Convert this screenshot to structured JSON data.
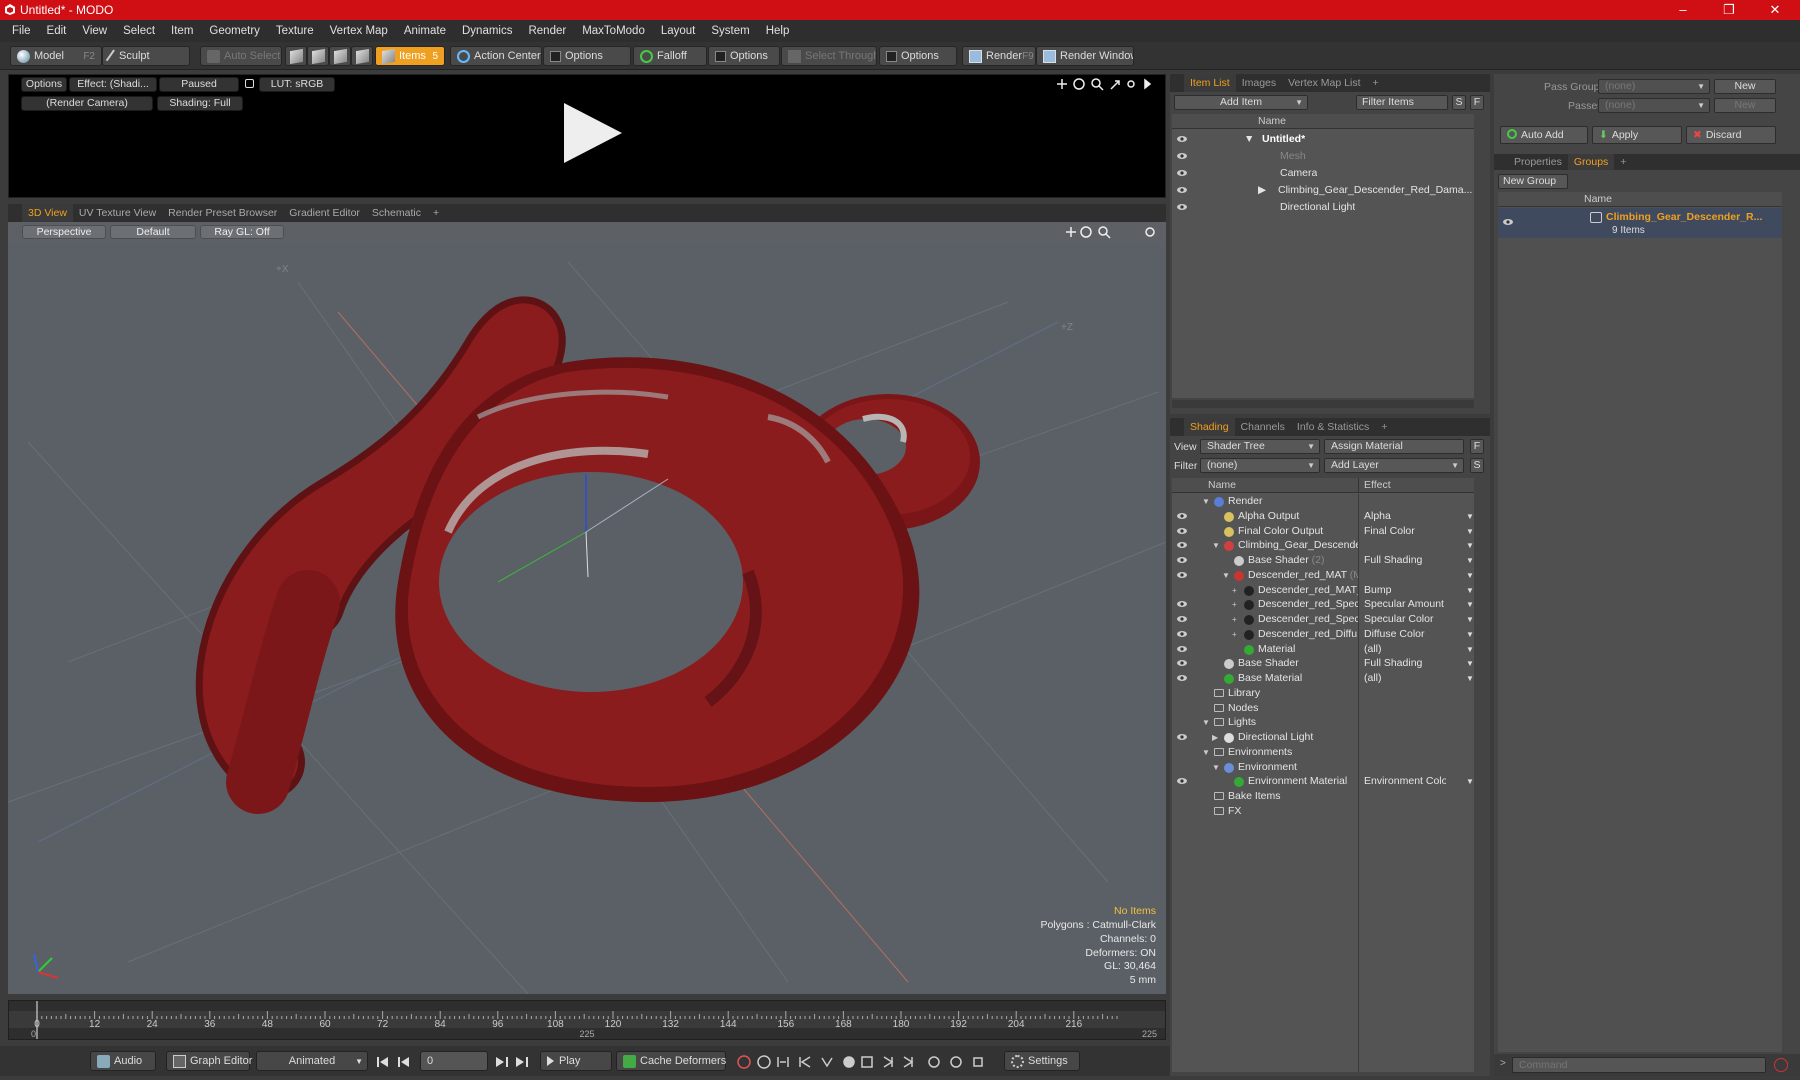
{
  "window": {
    "title": "Untitled* - MODO",
    "min": "–",
    "max": "❐",
    "close": "✕"
  },
  "menu": [
    "File",
    "Edit",
    "View",
    "Select",
    "Item",
    "Geometry",
    "Texture",
    "Vertex Map",
    "Animate",
    "Dynamics",
    "Render",
    "MaxToModo",
    "Layout",
    "System",
    "Help"
  ],
  "toolbar": {
    "model": "Model",
    "model_key": "F2",
    "sculpt": "Sculpt",
    "auto_select": "Auto Select",
    "items": "Items",
    "items_key": "5",
    "action_center": "Action Center",
    "options1": "Options",
    "falloff": "Falloff",
    "options2": "Options",
    "select_through": "Select Through",
    "options3": "Options",
    "render": "Render",
    "render_key": "F9",
    "render_window": "Render Window"
  },
  "preview": {
    "options": "Options",
    "effect": "Effect: (Shadi...",
    "paused": "Paused",
    "lut": "LUT: sRGB",
    "camera": "(Render Camera)",
    "shading": "Shading: Full"
  },
  "view_tabs": [
    "3D View",
    "UV Texture View",
    "Render Preset Browser",
    "Gradient Editor",
    "Schematic",
    "+"
  ],
  "viewport": {
    "perspective": "Perspective",
    "default": "Default",
    "raygl": "Ray GL: Off",
    "axis_x": "+X",
    "axis_z": "+Z",
    "info": {
      "no_items": "No Items",
      "polygons": "Polygons : Catmull-Clark",
      "channels": "Channels: 0",
      "deformers": "Deformers: ON",
      "gl": "GL: 30,464",
      "scale": "5 mm"
    }
  },
  "timeline": {
    "ticks": [
      "0",
      "12",
      "24",
      "36",
      "48",
      "60",
      "72",
      "84",
      "96",
      "108",
      "120",
      "132",
      "144",
      "156",
      "168",
      "180",
      "192",
      "204",
      "216"
    ],
    "start": "0",
    "mid": "225",
    "end": "225"
  },
  "bottom": {
    "audio": "Audio",
    "graph_editor": "Graph Editor",
    "animated": "Animated",
    "frame": "0",
    "play": "Play",
    "cache_deformers": "Cache Deformers",
    "settings": "Settings"
  },
  "item_list": {
    "tabs": [
      "Item List",
      "Images",
      "Vertex Map List",
      "+"
    ],
    "add_item": "Add Item",
    "filter_items": "Filter Items",
    "s": "S",
    "f": "F",
    "col_name": "Name",
    "items": [
      {
        "label": "Untitled*"
      },
      {
        "label": "Mesh"
      },
      {
        "label": "Camera"
      },
      {
        "label": "Climbing_Gear_Descender_Red_Dama..."
      },
      {
        "label": "Directional Light"
      }
    ]
  },
  "shading": {
    "tabs": [
      "Shading",
      "Channels",
      "Info & Statistics",
      "+"
    ],
    "view_label": "View",
    "view_value": "Shader Tree",
    "assign_material": "Assign Material",
    "filter_label": "Filter",
    "filter_value": "(none)",
    "add_layer": "Add Layer",
    "f": "F",
    "s": "S",
    "col_name": "Name",
    "col_effect": "Effect",
    "rows": [
      {
        "name": "Render",
        "effect": ""
      },
      {
        "name": "Alpha Output",
        "effect": "Alpha"
      },
      {
        "name": "Final Color Output",
        "effect": "Final Color"
      },
      {
        "name": "Climbing_Gear_Descender ...",
        "effect": ""
      },
      {
        "name": "Base Shader",
        "suffix": "(2)",
        "effect": "Full Shading"
      },
      {
        "name": "Descender_red_MAT",
        "suffix": "(M...",
        "effect": ""
      },
      {
        "name": "Descender_red_MAT_...",
        "effect": "Bump"
      },
      {
        "name": "Descender_red_Spec ...",
        "effect": "Specular Amount"
      },
      {
        "name": "Descender_red_Spec ...",
        "effect": "Specular Color"
      },
      {
        "name": "Descender_red_Diffu ...",
        "effect": "Diffuse Color"
      },
      {
        "name": "Material",
        "effect": "(all)"
      },
      {
        "name": "Base Shader",
        "effect": "Full Shading"
      },
      {
        "name": "Base Material",
        "effect": "(all)"
      },
      {
        "name": "Library",
        "effect": ""
      },
      {
        "name": "Nodes",
        "effect": ""
      },
      {
        "name": "Lights",
        "effect": ""
      },
      {
        "name": "Directional Light",
        "effect": ""
      },
      {
        "name": "Environments",
        "effect": ""
      },
      {
        "name": "Environment",
        "effect": ""
      },
      {
        "name": "Environment Material",
        "effect": "Environment Color"
      },
      {
        "name": "Bake Items",
        "effect": ""
      },
      {
        "name": "FX",
        "effect": ""
      }
    ]
  },
  "groups": {
    "pass_groups": "Pass Groups",
    "pass_value": "(none)",
    "new1": "New",
    "passes": "Passes",
    "passes_value": "(none)",
    "new2": "New",
    "auto_add": "Auto Add",
    "apply": "Apply",
    "discard": "Discard",
    "tabs": [
      "Properties",
      "Groups",
      "+"
    ],
    "new_group": "New Group",
    "col_name": "Name",
    "group_name": "Climbing_Gear_Descender_R...",
    "group_count": "9 Items"
  },
  "command": {
    "placeholder": "Command"
  },
  "colors": {
    "accent": "#f0a020",
    "title": "#d00f14",
    "model_red": "#8b1c1e"
  }
}
